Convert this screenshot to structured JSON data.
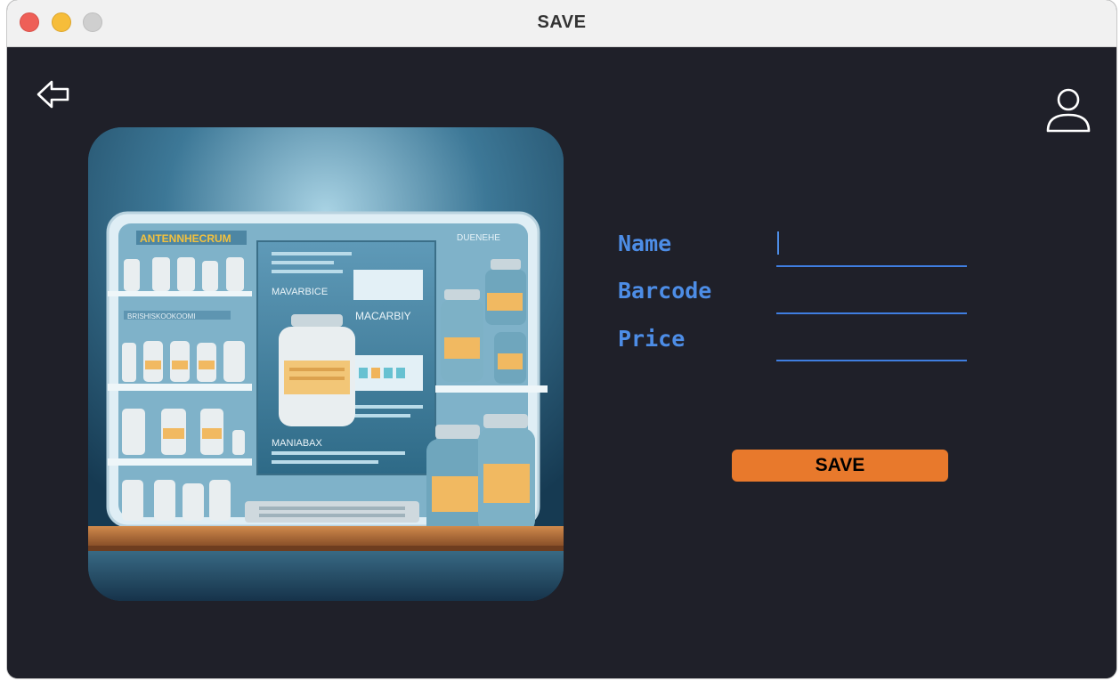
{
  "window": {
    "title": "SAVE"
  },
  "toolbar": {
    "back_icon": "arrow-left-icon",
    "user_icon": "user-profile-icon"
  },
  "hero": {
    "icon": "pharmacy-illustration",
    "sign_left": "ANTENNHECRUM",
    "sign_right": "DUENEHE",
    "shelf_label": "BRISHISKOOKOOMI",
    "screen_text_1": "MAVARBICE",
    "screen_text_2": "MACARBIY",
    "screen_text_3": "MANIABAX"
  },
  "form": {
    "name_label": "Name",
    "barcode_label": "Barcode",
    "price_label": "Price",
    "name_value": "",
    "barcode_value": "",
    "price_value": "",
    "save_label": "SAVE"
  },
  "colors": {
    "background": "#1f2029",
    "label": "#4d8de6",
    "underline": "#3f7ee0",
    "button": "#e8792c"
  }
}
